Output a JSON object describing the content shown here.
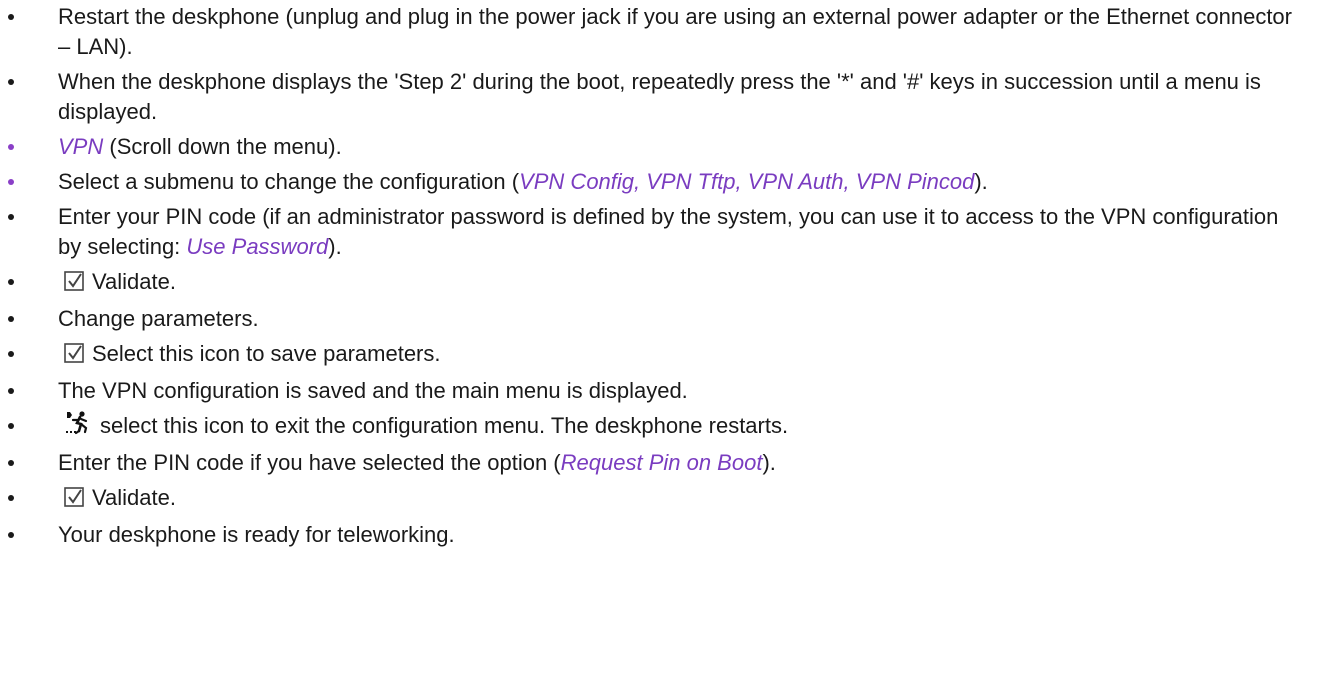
{
  "colors": {
    "text": "#1a1a1a",
    "accent": "#7a3cc0",
    "accent_bullet": "#8a3fc7"
  },
  "steps": [
    {
      "type": "text",
      "bullet": "black",
      "parts": [
        {
          "t": "Restart the deskphone (unplug and plug in the power jack if you are using an external power adapter or the Ethernet connector – LAN)."
        }
      ]
    },
    {
      "type": "text",
      "bullet": "black",
      "parts": [
        {
          "t": "When the deskphone displays the 'Step 2' during the boot, repeatedly press the '*' and '#' keys in succession until a menu is displayed."
        }
      ]
    },
    {
      "type": "text",
      "bullet": "purple",
      "parts": [
        {
          "t": "VPN",
          "em": true
        },
        {
          "t": " (Scroll down the menu)."
        }
      ]
    },
    {
      "type": "text",
      "bullet": "purple",
      "parts": [
        {
          "t": "Select a submenu to change the configuration ("
        },
        {
          "t": "VPN Config, VPN Tftp, VPN Auth, VPN Pincod",
          "em": true
        },
        {
          "t": ")."
        }
      ]
    },
    {
      "type": "text",
      "bullet": "black",
      "parts": [
        {
          "t": "Enter your PIN code (if an administrator password is defined by the system, you can use it to access to the VPN configuration by selecting: "
        },
        {
          "t": "Use Password",
          "em": true
        },
        {
          "t": ")."
        }
      ]
    },
    {
      "type": "icon",
      "bullet": "black",
      "icon": "checkbox-check-icon",
      "parts": [
        {
          "t": "Validate."
        }
      ]
    },
    {
      "type": "text",
      "bullet": "black",
      "parts": [
        {
          "t": "Change parameters."
        }
      ]
    },
    {
      "type": "icon",
      "bullet": "black",
      "icon": "checkbox-check-icon",
      "parts": [
        {
          "t": "Select this icon to save parameters."
        }
      ]
    },
    {
      "type": "text",
      "bullet": "black",
      "parts": [
        {
          "t": "The VPN configuration is saved and the main menu is displayed."
        }
      ]
    },
    {
      "type": "icon",
      "bullet": "black",
      "icon": "running-exit-icon",
      "parts": [
        {
          "t": "select this icon to exit the configuration menu. The deskphone restarts."
        }
      ]
    },
    {
      "type": "text",
      "bullet": "black",
      "parts": [
        {
          "t": "Enter the PIN code if you have selected the option ("
        },
        {
          "t": "Request Pin on Boot",
          "em": true
        },
        {
          "t": ")."
        }
      ]
    },
    {
      "type": "icon",
      "bullet": "black",
      "icon": "checkbox-check-icon",
      "parts": [
        {
          "t": "Validate."
        }
      ]
    },
    {
      "type": "text",
      "bullet": "black",
      "parts": [
        {
          "t": "Your deskphone is ready for teleworking."
        }
      ]
    }
  ]
}
